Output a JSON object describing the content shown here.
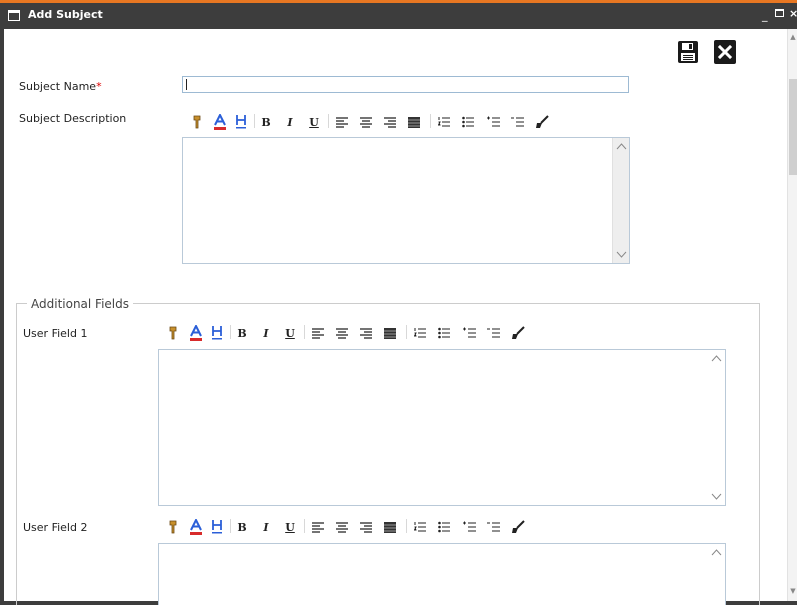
{
  "window": {
    "title": "Add Subject",
    "controls": {
      "minimize": "_",
      "close": "×"
    }
  },
  "actions": {
    "save_icon": "floppy-disk-icon",
    "close_icon": "x-box-icon"
  },
  "form": {
    "subject_name": {
      "label": "Subject Name",
      "required_mark": "*",
      "value": ""
    },
    "subject_description": {
      "label": "Subject Description"
    }
  },
  "additional_fields": {
    "legend": "Additional Fields",
    "user_field_1": {
      "label": "User Field 1"
    },
    "user_field_2": {
      "label": "User Field 2"
    }
  },
  "toolbar_buttons": [
    "paint-icon",
    "font-color-icon",
    "highlight-icon",
    "bold-icon",
    "italic-icon",
    "underline-icon",
    "align-left-icon",
    "align-center-icon",
    "align-right-icon",
    "align-justify-icon",
    "numbered-list-icon",
    "bulleted-list-icon",
    "indent-icon",
    "outdent-icon",
    "clear-format-icon"
  ],
  "colors": {
    "titlebar": "#3d3d3d",
    "accent": "#e87722",
    "font_color_bar": "#d82b2b",
    "highlight_letter": "#2b5fd8"
  }
}
